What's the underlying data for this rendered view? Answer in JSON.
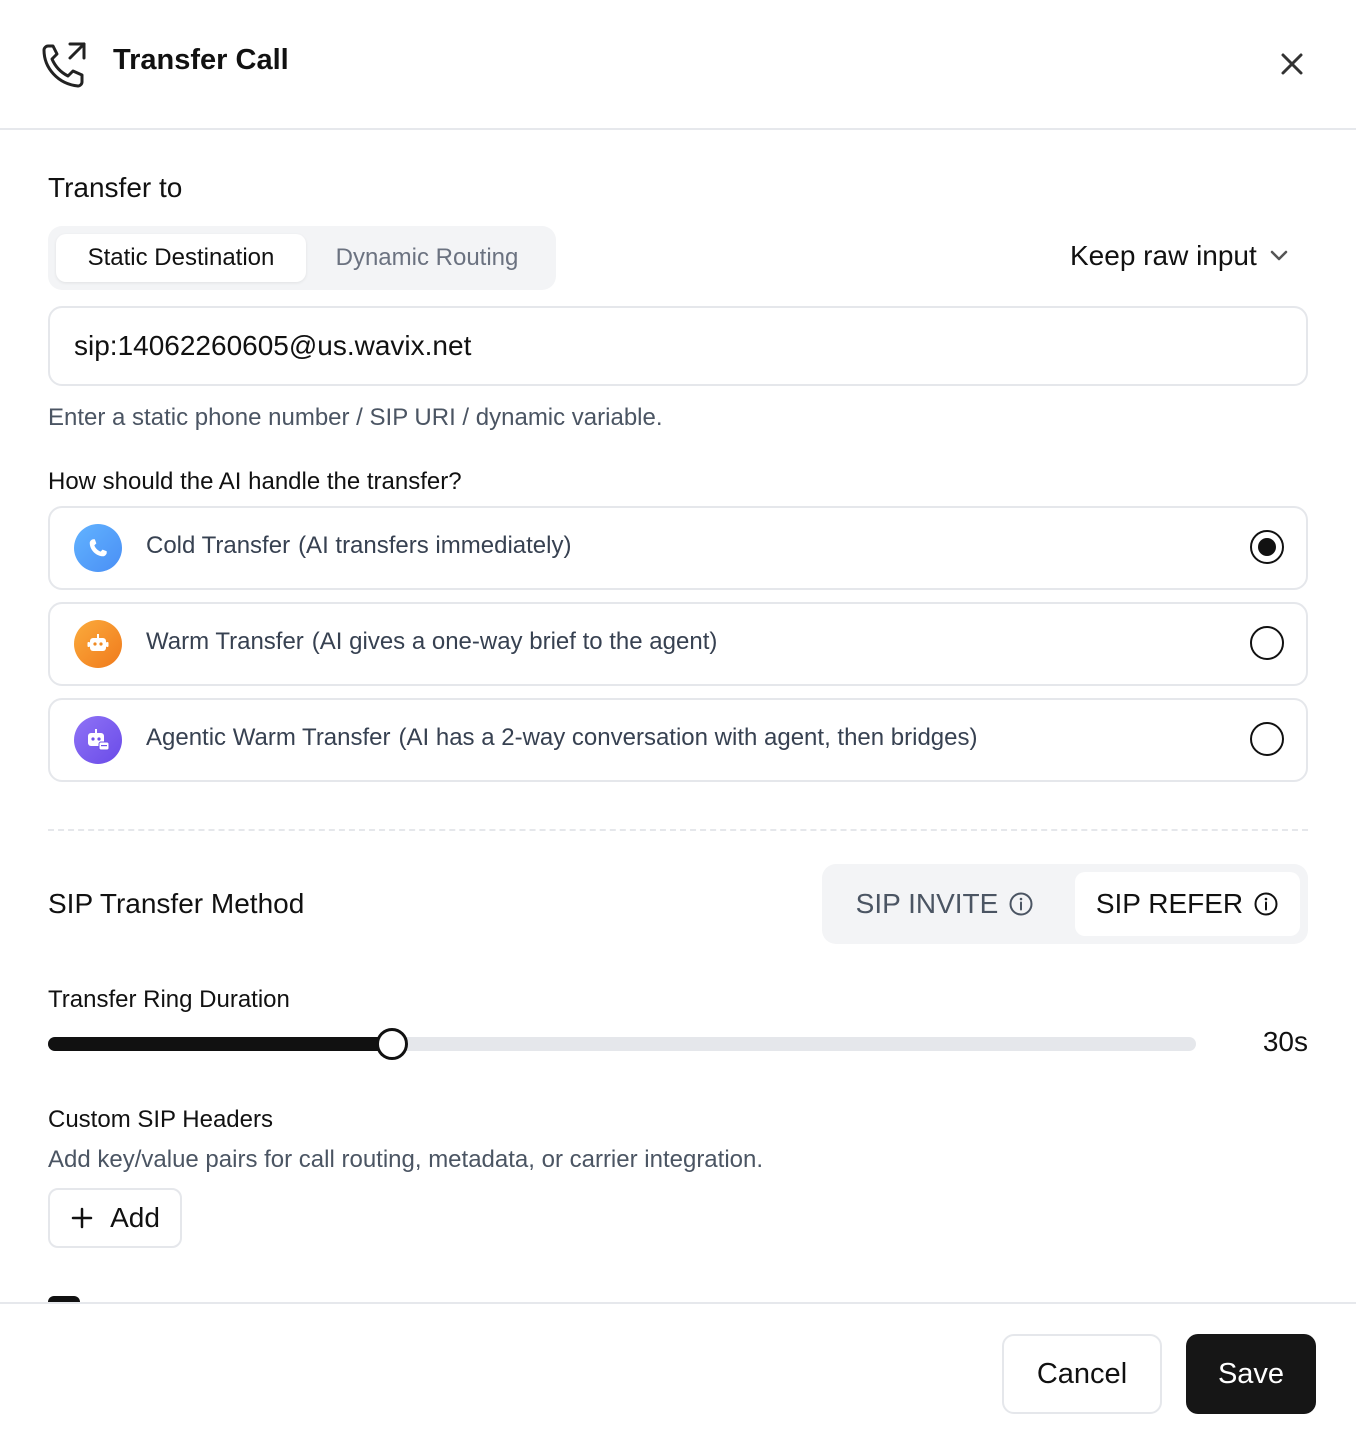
{
  "dialog": {
    "title": "Transfer Call",
    "icon": "phone-transfer-icon",
    "close_icon": "close-icon"
  },
  "transfer_to": {
    "heading": "Transfer to",
    "tabs": [
      {
        "label": "Static Destination",
        "active": true
      },
      {
        "label": "Dynamic Routing",
        "active": false
      }
    ],
    "format_dropdown": {
      "value": "Keep raw input",
      "icon": "chevron-down-icon"
    },
    "destination_value": "sip:14062260605@us.wavix.net",
    "helper": "Enter a static phone number / SIP URI / dynamic variable."
  },
  "handling": {
    "question": "How should the AI handle the transfer?",
    "options": [
      {
        "title": "Cold Transfer",
        "description": "(AI transfers immediately)",
        "icon": "phone-icon",
        "color": "#4f9cf9",
        "selected": true
      },
      {
        "title": "Warm Transfer",
        "description": "(AI gives a one-way brief to the agent)",
        "icon": "robot-icon",
        "color": "#f59e2a",
        "selected": false
      },
      {
        "title": "Agentic Warm Transfer",
        "description": "(AI has a 2-way conversation with agent, then bridges)",
        "icon": "robot-chat-icon",
        "color": "#7c5cf0",
        "selected": false
      }
    ]
  },
  "sip_method": {
    "heading": "SIP Transfer Method",
    "options": [
      {
        "label": "SIP INVITE",
        "icon": "info-icon",
        "active": false
      },
      {
        "label": "SIP REFER",
        "icon": "info-icon",
        "active": true
      }
    ]
  },
  "ring_duration": {
    "label": "Transfer Ring Duration",
    "value_text": "30s",
    "fraction": 0.3
  },
  "custom_headers": {
    "label": "Custom SIP Headers",
    "helper": "Add key/value pairs for call routing, metadata, or carrier integration.",
    "add_label": "Add",
    "add_icon": "plus-icon"
  },
  "footer": {
    "cancel_label": "Cancel",
    "save_label": "Save"
  }
}
